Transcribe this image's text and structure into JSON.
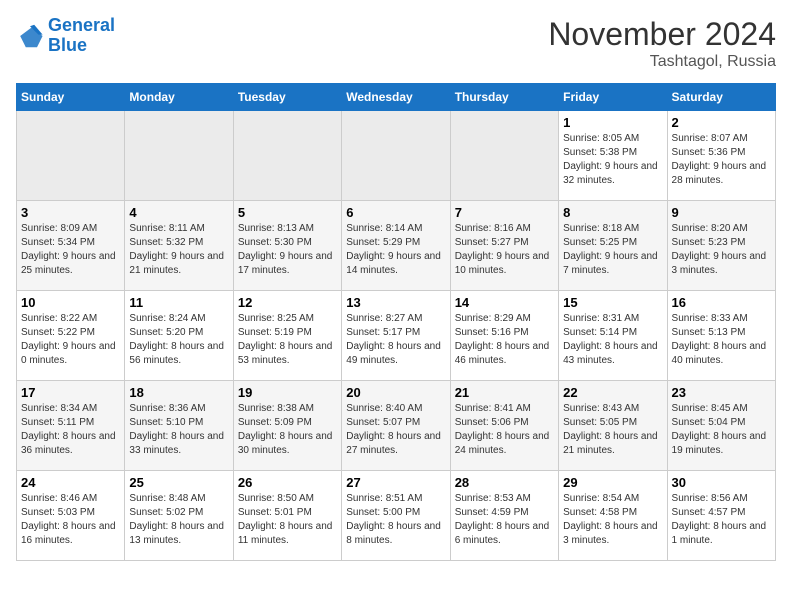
{
  "logo": {
    "line1": "General",
    "line2": "Blue"
  },
  "title": "November 2024",
  "subtitle": "Tashtagol, Russia",
  "days_of_week": [
    "Sunday",
    "Monday",
    "Tuesday",
    "Wednesday",
    "Thursday",
    "Friday",
    "Saturday"
  ],
  "weeks": [
    [
      {
        "day": "",
        "info": ""
      },
      {
        "day": "",
        "info": ""
      },
      {
        "day": "",
        "info": ""
      },
      {
        "day": "",
        "info": ""
      },
      {
        "day": "",
        "info": ""
      },
      {
        "day": "1",
        "info": "Sunrise: 8:05 AM\nSunset: 5:38 PM\nDaylight: 9 hours and 32 minutes."
      },
      {
        "day": "2",
        "info": "Sunrise: 8:07 AM\nSunset: 5:36 PM\nDaylight: 9 hours and 28 minutes."
      }
    ],
    [
      {
        "day": "3",
        "info": "Sunrise: 8:09 AM\nSunset: 5:34 PM\nDaylight: 9 hours and 25 minutes."
      },
      {
        "day": "4",
        "info": "Sunrise: 8:11 AM\nSunset: 5:32 PM\nDaylight: 9 hours and 21 minutes."
      },
      {
        "day": "5",
        "info": "Sunrise: 8:13 AM\nSunset: 5:30 PM\nDaylight: 9 hours and 17 minutes."
      },
      {
        "day": "6",
        "info": "Sunrise: 8:14 AM\nSunset: 5:29 PM\nDaylight: 9 hours and 14 minutes."
      },
      {
        "day": "7",
        "info": "Sunrise: 8:16 AM\nSunset: 5:27 PM\nDaylight: 9 hours and 10 minutes."
      },
      {
        "day": "8",
        "info": "Sunrise: 8:18 AM\nSunset: 5:25 PM\nDaylight: 9 hours and 7 minutes."
      },
      {
        "day": "9",
        "info": "Sunrise: 8:20 AM\nSunset: 5:23 PM\nDaylight: 9 hours and 3 minutes."
      }
    ],
    [
      {
        "day": "10",
        "info": "Sunrise: 8:22 AM\nSunset: 5:22 PM\nDaylight: 9 hours and 0 minutes."
      },
      {
        "day": "11",
        "info": "Sunrise: 8:24 AM\nSunset: 5:20 PM\nDaylight: 8 hours and 56 minutes."
      },
      {
        "day": "12",
        "info": "Sunrise: 8:25 AM\nSunset: 5:19 PM\nDaylight: 8 hours and 53 minutes."
      },
      {
        "day": "13",
        "info": "Sunrise: 8:27 AM\nSunset: 5:17 PM\nDaylight: 8 hours and 49 minutes."
      },
      {
        "day": "14",
        "info": "Sunrise: 8:29 AM\nSunset: 5:16 PM\nDaylight: 8 hours and 46 minutes."
      },
      {
        "day": "15",
        "info": "Sunrise: 8:31 AM\nSunset: 5:14 PM\nDaylight: 8 hours and 43 minutes."
      },
      {
        "day": "16",
        "info": "Sunrise: 8:33 AM\nSunset: 5:13 PM\nDaylight: 8 hours and 40 minutes."
      }
    ],
    [
      {
        "day": "17",
        "info": "Sunrise: 8:34 AM\nSunset: 5:11 PM\nDaylight: 8 hours and 36 minutes."
      },
      {
        "day": "18",
        "info": "Sunrise: 8:36 AM\nSunset: 5:10 PM\nDaylight: 8 hours and 33 minutes."
      },
      {
        "day": "19",
        "info": "Sunrise: 8:38 AM\nSunset: 5:09 PM\nDaylight: 8 hours and 30 minutes."
      },
      {
        "day": "20",
        "info": "Sunrise: 8:40 AM\nSunset: 5:07 PM\nDaylight: 8 hours and 27 minutes."
      },
      {
        "day": "21",
        "info": "Sunrise: 8:41 AM\nSunset: 5:06 PM\nDaylight: 8 hours and 24 minutes."
      },
      {
        "day": "22",
        "info": "Sunrise: 8:43 AM\nSunset: 5:05 PM\nDaylight: 8 hours and 21 minutes."
      },
      {
        "day": "23",
        "info": "Sunrise: 8:45 AM\nSunset: 5:04 PM\nDaylight: 8 hours and 19 minutes."
      }
    ],
    [
      {
        "day": "24",
        "info": "Sunrise: 8:46 AM\nSunset: 5:03 PM\nDaylight: 8 hours and 16 minutes."
      },
      {
        "day": "25",
        "info": "Sunrise: 8:48 AM\nSunset: 5:02 PM\nDaylight: 8 hours and 13 minutes."
      },
      {
        "day": "26",
        "info": "Sunrise: 8:50 AM\nSunset: 5:01 PM\nDaylight: 8 hours and 11 minutes."
      },
      {
        "day": "27",
        "info": "Sunrise: 8:51 AM\nSunset: 5:00 PM\nDaylight: 8 hours and 8 minutes."
      },
      {
        "day": "28",
        "info": "Sunrise: 8:53 AM\nSunset: 4:59 PM\nDaylight: 8 hours and 6 minutes."
      },
      {
        "day": "29",
        "info": "Sunrise: 8:54 AM\nSunset: 4:58 PM\nDaylight: 8 hours and 3 minutes."
      },
      {
        "day": "30",
        "info": "Sunrise: 8:56 AM\nSunset: 4:57 PM\nDaylight: 8 hours and 1 minute."
      }
    ]
  ]
}
